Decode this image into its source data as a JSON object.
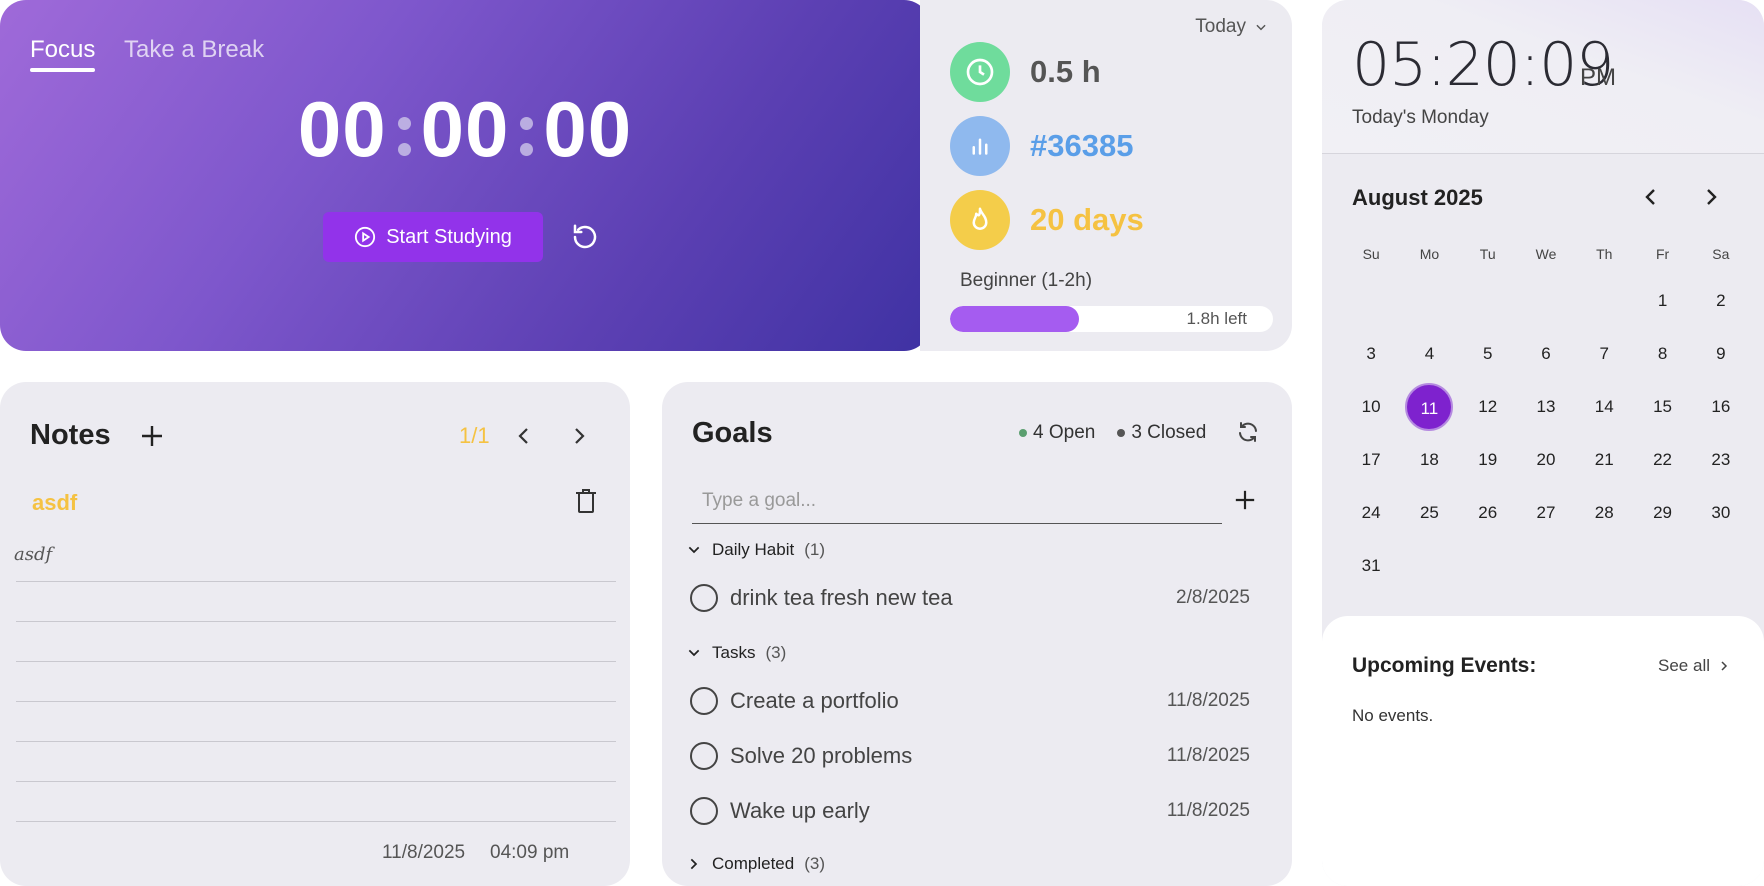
{
  "timer": {
    "tabs": [
      "Focus",
      "Take a Break"
    ],
    "hours": "00",
    "minutes": "00",
    "seconds": "00",
    "start_label": "Start Studying"
  },
  "stats": {
    "period": "Today",
    "hours": "0.5 h",
    "rank": "#36385",
    "streak": "20 days",
    "level": "Beginner (1-2h)",
    "progress_fraction": 0.4,
    "progress_text": "1.8h left",
    "colors": {
      "clock": "#6fdc9c",
      "rank": "#8fb9ee",
      "streak": "#f4cd4a",
      "rank_text": "#5a9ee8",
      "streak_text": "#f5c242"
    }
  },
  "notes": {
    "title": "Notes",
    "page": "1/1",
    "note_title": "asdf",
    "note_text": "asdf",
    "date": "11/8/2025",
    "time": "04:09 pm"
  },
  "goals": {
    "title": "Goals",
    "open": "4 Open",
    "closed": "3 Closed",
    "input_placeholder": "Type a goal...",
    "groups": [
      {
        "name": "Daily Habit",
        "count": "(1)",
        "items": [
          {
            "text": "drink tea fresh new tea",
            "date": "2/8/2025"
          }
        ]
      },
      {
        "name": "Tasks",
        "count": "(3)",
        "items": [
          {
            "text": "Create a portfolio",
            "date": "11/8/2025"
          },
          {
            "text": "Solve 20 problems",
            "date": "11/8/2025"
          },
          {
            "text": "Wake up early",
            "date": "11/8/2025"
          }
        ]
      },
      {
        "name": "Completed",
        "count": "(3)",
        "items": []
      }
    ]
  },
  "clock": {
    "time": "05:20:09",
    "ampm": "PM",
    "weekday": "Today's Monday"
  },
  "calendar": {
    "month": "August 2025",
    "weekdays": [
      "Su",
      "Mo",
      "Tu",
      "We",
      "Th",
      "Fr",
      "Sa"
    ],
    "weeks": [
      [
        "",
        "",
        "",
        "",
        "",
        "1",
        "2"
      ],
      [
        "3",
        "4",
        "5",
        "6",
        "7",
        "8",
        "9"
      ],
      [
        "10",
        "11",
        "12",
        "13",
        "14",
        "15",
        "16"
      ],
      [
        "17",
        "18",
        "19",
        "20",
        "21",
        "22",
        "23"
      ],
      [
        "24",
        "25",
        "26",
        "27",
        "28",
        "29",
        "30"
      ],
      [
        "31",
        "",
        "",
        "",
        "",
        "",
        ""
      ]
    ],
    "selected": "11"
  },
  "events": {
    "title": "Upcoming Events:",
    "see_all": "See all",
    "empty": "No events."
  }
}
